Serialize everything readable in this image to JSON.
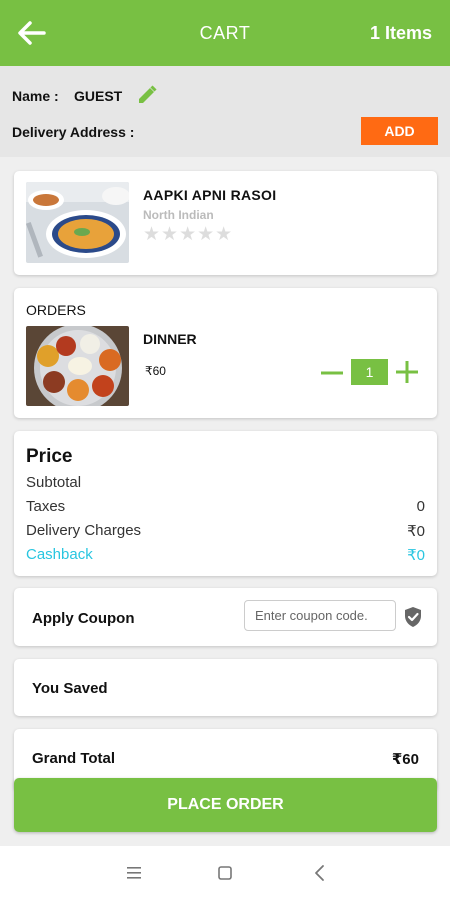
{
  "header": {
    "title": "CART",
    "items_count": "1 Items"
  },
  "user": {
    "name_label": "Name :",
    "name_value": "GUEST",
    "address_label": "Delivery Address :",
    "add_label": "ADD"
  },
  "restaurant": {
    "name": "AAPKI APNI RASOI",
    "cuisine": "North Indian",
    "rating": 0,
    "stars": "★★★★★"
  },
  "orders": {
    "label": "ORDERS",
    "items": [
      {
        "name": "DINNER",
        "price": "₹60",
        "quantity": "1"
      }
    ]
  },
  "price": {
    "title": "Price",
    "subtotal_label": "Subtotal",
    "taxes_label": "Taxes",
    "taxes_value": "0",
    "delivery_label": "Delivery Charges",
    "delivery_value": "₹0",
    "cashback_label": "Cashback",
    "cashback_value": "₹0"
  },
  "coupon": {
    "label": "Apply Coupon",
    "placeholder": "Enter coupon code.",
    "value": ""
  },
  "saved": {
    "label": "You Saved"
  },
  "grand_total": {
    "label": "Grand Total",
    "value": "₹60"
  },
  "place_order": {
    "label": "PLACE ORDER"
  },
  "colors": {
    "primary_green": "#78c043",
    "accent_orange": "#ff6a13",
    "cashback_cyan": "#29c6e0"
  },
  "icons": {
    "back": "arrow-left-icon",
    "edit": "pencil-icon",
    "minus": "minus-icon",
    "plus": "plus-icon",
    "shield": "shield-check-icon",
    "nav_menu": "menu-icon",
    "nav_home": "home-square-icon",
    "nav_back": "chevron-left-icon"
  }
}
